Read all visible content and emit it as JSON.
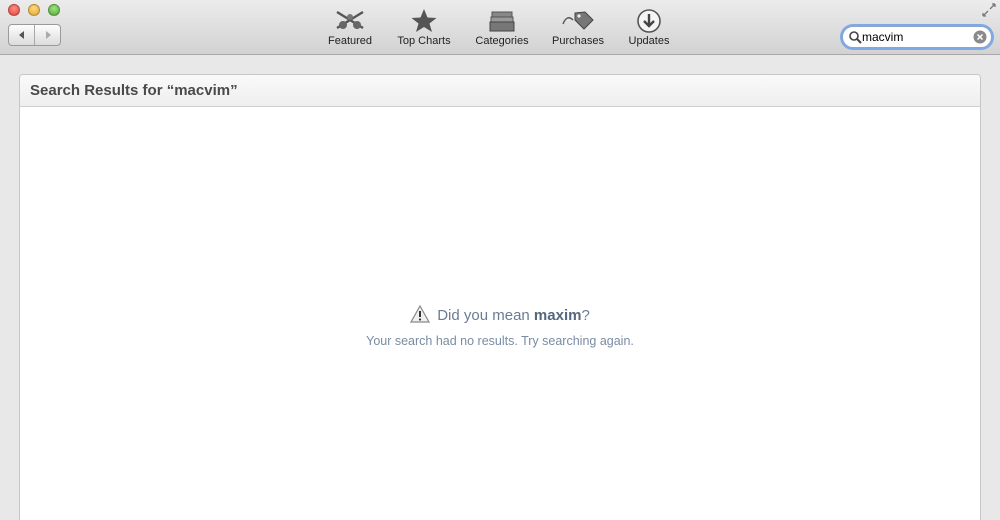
{
  "window": {
    "controls": [
      "close",
      "minimize",
      "zoom"
    ]
  },
  "nav": {
    "back_icon": "triangle-left-icon",
    "forward_icon": "triangle-right-icon"
  },
  "toolbar": {
    "tabs": [
      {
        "label": "Featured",
        "icon": "featured-icon"
      },
      {
        "label": "Top Charts",
        "icon": "star-icon"
      },
      {
        "label": "Categories",
        "icon": "categories-icon"
      },
      {
        "label": "Purchases",
        "icon": "tag-icon"
      },
      {
        "label": "Updates",
        "icon": "download-arrow-icon"
      }
    ]
  },
  "search": {
    "value": "macvim",
    "placeholder": ""
  },
  "results": {
    "header_prefix": "Search Results for ",
    "header_query": "“macvim”",
    "suggestion_prefix": "Did you mean ",
    "suggestion_term": "maxim",
    "suggestion_suffix": "?",
    "message": "Your search had no results. Try searching again."
  },
  "colors": {
    "accent": "#7fa9e6",
    "message_text": "#6a7c95"
  }
}
